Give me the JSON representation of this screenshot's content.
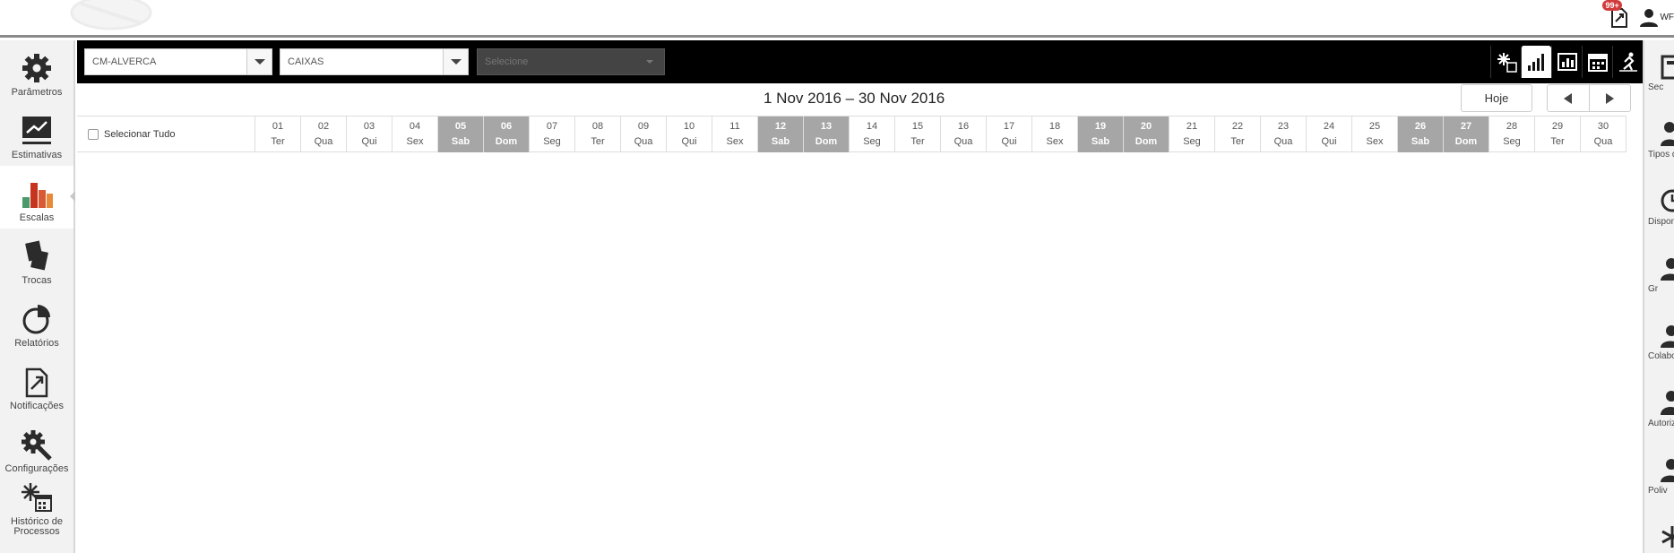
{
  "header": {
    "notification_badge": "99+",
    "user_initials": "WF"
  },
  "left_nav": [
    {
      "id": "parametros",
      "label": "Parâmetros",
      "icon": "gear-icon"
    },
    {
      "id": "estimativas",
      "label": "Estimativas",
      "icon": "trend-chart-icon"
    },
    {
      "id": "escalas",
      "label": "Escalas",
      "icon": "bar-chart-icon",
      "active": true
    },
    {
      "id": "trocas",
      "label": "Trocas",
      "icon": "swap-icon"
    },
    {
      "id": "relatorios",
      "label": "Relatórios",
      "icon": "pie-chart-icon"
    },
    {
      "id": "notificacoes",
      "label": "Notificações",
      "icon": "notification-icon"
    },
    {
      "id": "configuracoes",
      "label": "Configurações",
      "icon": "wrench-gear-icon"
    },
    {
      "id": "historico",
      "label": "Histórico de Processos",
      "icon": "process-history-icon"
    }
  ],
  "right_nav": [
    {
      "label": "Sec",
      "icon": "building-icon"
    },
    {
      "label": "Tipos d",
      "icon": "person-icon"
    },
    {
      "label": "Dispon",
      "icon": "clock-icon"
    },
    {
      "label": "Gr",
      "icon": "group-icon"
    },
    {
      "label": "Colabo",
      "icon": "person-icon"
    },
    {
      "label": "Autoriz Tr",
      "icon": "person-icon"
    },
    {
      "label": "Poliv",
      "icon": "person-tools-icon"
    },
    {
      "label": "",
      "icon": "asterisk-icon"
    }
  ],
  "toolbar": {
    "store_select": "CM-ALVERCA",
    "section_select": "CAIXAS",
    "third_select_placeholder": "Selecione",
    "view_icons": [
      "process-icon",
      "bar-chart-icon",
      "report-icon",
      "calendar-icon",
      "runner-icon"
    ],
    "active_view": 1
  },
  "calendar": {
    "period_title": "1 Nov 2016 – 30 Nov 2016",
    "today_label": "Hoje",
    "select_all_label": "Selecionar Tudo",
    "days": [
      {
        "n": "01",
        "w": "Ter",
        "weekend": false
      },
      {
        "n": "02",
        "w": "Qua",
        "weekend": false
      },
      {
        "n": "03",
        "w": "Qui",
        "weekend": false
      },
      {
        "n": "04",
        "w": "Sex",
        "weekend": false
      },
      {
        "n": "05",
        "w": "Sab",
        "weekend": true
      },
      {
        "n": "06",
        "w": "Dom",
        "weekend": true
      },
      {
        "n": "07",
        "w": "Seg",
        "weekend": false
      },
      {
        "n": "08",
        "w": "Ter",
        "weekend": false
      },
      {
        "n": "09",
        "w": "Qua",
        "weekend": false
      },
      {
        "n": "10",
        "w": "Qui",
        "weekend": false
      },
      {
        "n": "11",
        "w": "Sex",
        "weekend": false
      },
      {
        "n": "12",
        "w": "Sab",
        "weekend": true
      },
      {
        "n": "13",
        "w": "Dom",
        "weekend": true
      },
      {
        "n": "14",
        "w": "Seg",
        "weekend": false
      },
      {
        "n": "15",
        "w": "Ter",
        "weekend": false
      },
      {
        "n": "16",
        "w": "Qua",
        "weekend": false
      },
      {
        "n": "17",
        "w": "Qui",
        "weekend": false
      },
      {
        "n": "18",
        "w": "Sex",
        "weekend": false
      },
      {
        "n": "19",
        "w": "Sab",
        "weekend": true
      },
      {
        "n": "20",
        "w": "Dom",
        "weekend": true
      },
      {
        "n": "21",
        "w": "Seg",
        "weekend": false
      },
      {
        "n": "22",
        "w": "Ter",
        "weekend": false
      },
      {
        "n": "23",
        "w": "Qua",
        "weekend": false
      },
      {
        "n": "24",
        "w": "Qui",
        "weekend": false
      },
      {
        "n": "25",
        "w": "Sex",
        "weekend": false
      },
      {
        "n": "26",
        "w": "Sab",
        "weekend": true
      },
      {
        "n": "27",
        "w": "Dom",
        "weekend": true
      },
      {
        "n": "28",
        "w": "Seg",
        "weekend": false
      },
      {
        "n": "29",
        "w": "Ter",
        "weekend": false
      },
      {
        "n": "30",
        "w": "Qua",
        "weekend": false
      }
    ]
  },
  "colors": {
    "weekend_bg": "#a6a6a6",
    "toolbar_bg": "#000000",
    "sidebar_bg": "#f2f2f2",
    "badge": "#d23b3b"
  }
}
